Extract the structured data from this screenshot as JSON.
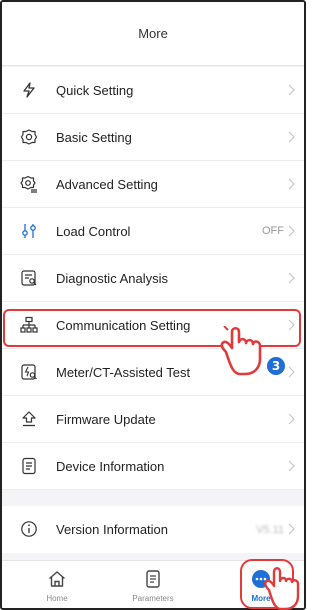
{
  "header": {
    "title": "More"
  },
  "menu": {
    "items": [
      {
        "label": "Quick Setting",
        "value": ""
      },
      {
        "label": "Basic Setting",
        "value": ""
      },
      {
        "label": "Advanced Setting",
        "value": ""
      },
      {
        "label": "Load Control",
        "value": "OFF"
      },
      {
        "label": "Diagnostic Analysis",
        "value": ""
      },
      {
        "label": "Communication Setting",
        "value": ""
      },
      {
        "label": "Meter/CT-Assisted Test",
        "value": ""
      },
      {
        "label": "Firmware Update",
        "value": ""
      },
      {
        "label": "Device Information",
        "value": ""
      }
    ],
    "version": {
      "label": "Version Information",
      "value": "V5.11"
    }
  },
  "annotation": {
    "step": "3"
  },
  "tabbar": {
    "tabs": [
      {
        "label": "Home"
      },
      {
        "label": "Parameters"
      },
      {
        "label": "More"
      }
    ]
  },
  "colors": {
    "accent": "#1f6fd6",
    "highlight": "#e23a3a"
  }
}
